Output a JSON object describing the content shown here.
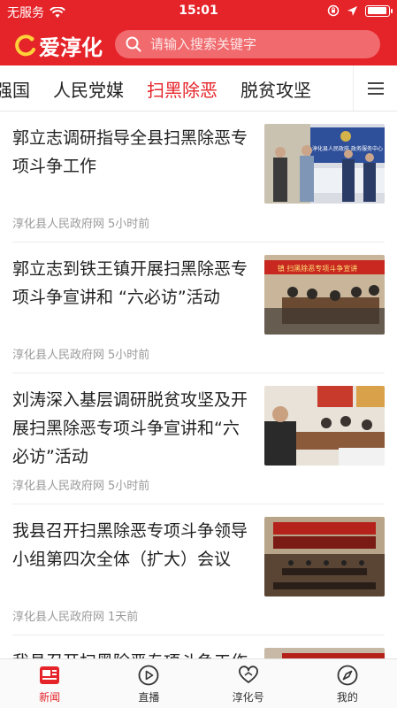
{
  "status_bar": {
    "carrier": "无服务",
    "time": "15:01",
    "battery_level": 0.95
  },
  "header": {
    "logo_text": "爱淳化",
    "search_placeholder": "请输入搜索关键字"
  },
  "tabs": [
    {
      "label": "强国"
    },
    {
      "label": "人民党媒"
    },
    {
      "label": "扫黑除恶",
      "active": true
    },
    {
      "label": "脱贫攻坚"
    }
  ],
  "articles": [
    {
      "title": "郭立志调研指导全县扫黑除恶专项斗争工作",
      "source": "淳化县人民政府网",
      "time": "5小时前",
      "thumb_text": "淳化县人民政府 政务服务中心"
    },
    {
      "title": "郭立志到铁王镇开展扫黑除恶专项斗争宣讲和 “六必访”活动",
      "source": "淳化县人民政府网",
      "time": "5小时前",
      "thumb_text": "镇 扫黑除恶专项斗争宣讲"
    },
    {
      "title": "刘涛深入基层调研脱贫攻坚及开展扫黑除恶专项斗争宣讲和“六必访”活动",
      "source": "淳化县人民政府网",
      "time": "5小时前",
      "thumb_text": ""
    },
    {
      "title": "我县召开扫黑除恶专项斗争领导小组第四次全体（扩大）会议",
      "source": "淳化县人民政府网",
      "time": "1天前",
      "thumb_text": ""
    },
    {
      "title": "我县召开扫黑除恶专项斗争工作例会",
      "source": "",
      "time": "",
      "thumb_text": ""
    }
  ],
  "bottom_nav": [
    {
      "label": "新闻",
      "icon": "news-icon",
      "active": true
    },
    {
      "label": "直播",
      "icon": "play-icon"
    },
    {
      "label": "淳化号",
      "icon": "heart-icon"
    },
    {
      "label": "我的",
      "icon": "compass-icon"
    }
  ],
  "colors": {
    "brand": "#e5242a",
    "meta_text": "#9a9a9a"
  }
}
